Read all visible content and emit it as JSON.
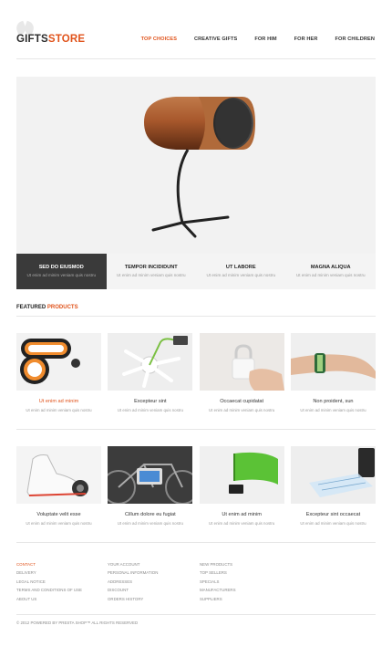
{
  "header": {
    "logo_part1": "GIFTS",
    "logo_part2": "STORE",
    "nav": [
      "TOP CHOICES",
      "CREATIVE GIFTS",
      "FOR HIM",
      "FOR HER",
      "FOR CHILDREN"
    ]
  },
  "hero": {
    "slides": [
      {
        "title": "SED DO EIUSMOD",
        "sub": "Ut enim ad minim veniam quis nostru"
      },
      {
        "title": "TEMPOR INCIDIDUNT",
        "sub": "Ut enim ad minim veniam quis nostru"
      },
      {
        "title": "UT LABORE",
        "sub": "Ut enim ad minim veniam quis nostru"
      },
      {
        "title": "MAGNA ALIQUA",
        "sub": "Ut enim ad minim veniam quis nostru"
      }
    ]
  },
  "featured": {
    "title_part1": "FEATURED",
    "title_part2": "PRODUCTS"
  },
  "products": [
    {
      "name": "Ut enim ad minim",
      "desc": "Ut enim ad minim veniam quis nostru",
      "icon": "figure-eight-speaker"
    },
    {
      "name": "Excepteur sint",
      "desc": "Ut enim ad minim veniam quis nostru",
      "icon": "usb-hub"
    },
    {
      "name": "Occaecat cupidatat",
      "desc": "Ut enim ad minim veniam quis nostru",
      "icon": "usb-lock"
    },
    {
      "name": "Non proident, sun",
      "desc": "Ut enim ad minim veniam quis nostru",
      "icon": "usb-bracelet"
    },
    {
      "name": "Voluptate velit esse",
      "desc": "Ut enim ad minim veniam quis nostru",
      "icon": "speaker-shoe"
    },
    {
      "name": "Cillum dolore eu fugiat",
      "desc": "Ut enim ad minim veniam quis nostru",
      "icon": "bike-dock"
    },
    {
      "name": "Ut enim ad minim",
      "desc": "Ut enim ad minim veniam quis nostru",
      "icon": "phone-dock"
    },
    {
      "name": "Excepteur sint occaecat",
      "desc": "Ut enim ad minim veniam quis nostru",
      "icon": "projection-keyboard"
    }
  ],
  "footer": {
    "col1": [
      "CONTACT",
      "DELIVERY",
      "LEGAL NOTICE",
      "TERMS AND CONDITIONS OF USE",
      "ABOUT US"
    ],
    "col2": [
      "YOUR ACCOUNT",
      "PERSONAL INFORMATION",
      "ADDRESSES",
      "DISCOUNT",
      "ORDERS HISTORY"
    ],
    "col3": [
      "NEW PRODUCTS",
      "TOP SELLERS",
      "SPECIALS",
      "MANUFACTURERS",
      "SUPPLIERS"
    ],
    "copyright": "© 2012 POWERED BY PRESTA SHOP™ ALL RIGHTS RESERVED"
  },
  "colors": {
    "accent": "#e0531b",
    "dark": "#3a3a3a"
  }
}
